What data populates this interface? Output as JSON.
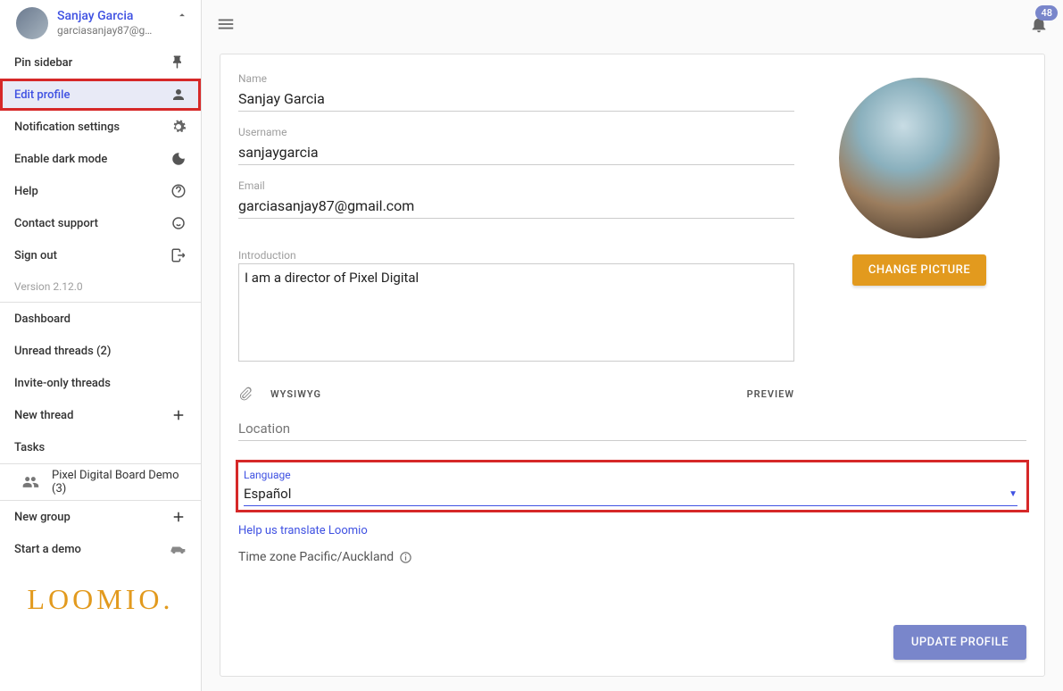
{
  "user": {
    "name": "Sanjay Garcia",
    "email": "garciasanjay87@gmail.c..."
  },
  "sidebar": {
    "pin": "Pin sidebar",
    "edit": "Edit profile",
    "notif": "Notification settings",
    "dark": "Enable dark mode",
    "help": "Help",
    "support": "Contact support",
    "signout": "Sign out",
    "version": "Version 2.12.0",
    "dashboard": "Dashboard",
    "unread": "Unread threads (2)",
    "invite": "Invite-only threads",
    "newthread": "New thread",
    "tasks": "Tasks",
    "group": "Pixel Digital Board Demo (3)",
    "newgroup": "New group",
    "demo": "Start a demo",
    "logo": "LOOMIO."
  },
  "topbar": {
    "badge": "48"
  },
  "profile": {
    "name_label": "Name",
    "name": "Sanjay Garcia",
    "username_label": "Username",
    "username": "sanjaygarcia",
    "email_label": "Email",
    "email": "garciasanjay87@gmail.com",
    "intro_label": "Introduction",
    "intro": "I am a director of Pixel Digital",
    "wysiwyg": "WYSIWYG",
    "preview": "PREVIEW",
    "location_placeholder": "Location",
    "lang_label": "Language",
    "lang": "Español",
    "translate_link": "Help us translate Loomio",
    "tz": "Time zone Pacific/Auckland",
    "change_btn": "CHANGE PICTURE",
    "update_btn": "UPDATE PROFILE"
  }
}
